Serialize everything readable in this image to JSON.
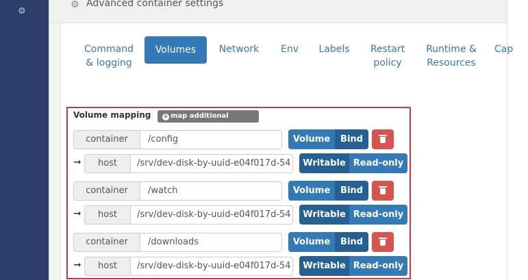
{
  "sidebar": {
    "icon": "gears-icon"
  },
  "panel": {
    "title": "Advanced container settings",
    "icon": "gear-icon"
  },
  "tabs": [
    {
      "label": "Command & logging",
      "active": false
    },
    {
      "label": "Volumes",
      "active": true
    },
    {
      "label": "Network",
      "active": false
    },
    {
      "label": "Env",
      "active": false
    },
    {
      "label": "Labels",
      "active": false
    },
    {
      "label": "Restart policy",
      "active": false
    },
    {
      "label": "Runtime & Resources",
      "active": false
    },
    {
      "label": "Cap",
      "active": false
    }
  ],
  "volumes": {
    "title": "Volume mapping",
    "add_label": "map additional volume",
    "rows": [
      {
        "container_label": "container",
        "container_path": "/config",
        "host_label": "host",
        "host_path": "/srv/dev-disk-by-uuid-e04f017d-54",
        "type_volume": "Volume",
        "type_bind": "Bind",
        "writable": "Writable",
        "readonly": "Read-only"
      },
      {
        "container_label": "container",
        "container_path": "/watch",
        "host_label": "host",
        "host_path": "/srv/dev-disk-by-uuid-e04f017d-54",
        "type_volume": "Volume",
        "type_bind": "Bind",
        "writable": "Writable",
        "readonly": "Read-only"
      },
      {
        "container_label": "container",
        "container_path": "/downloads",
        "host_label": "host",
        "host_path": "/srv/dev-disk-by-uuid-e04f017d-54",
        "type_volume": "Volume",
        "type_bind": "Bind",
        "writable": "Writable",
        "readonly": "Read-only"
      }
    ]
  },
  "colors": {
    "accent": "#337ab7",
    "accent_dark": "#265f92",
    "danger": "#d9534f",
    "highlight_border": "#d0363f",
    "sidebar": "#2d3e6a"
  }
}
